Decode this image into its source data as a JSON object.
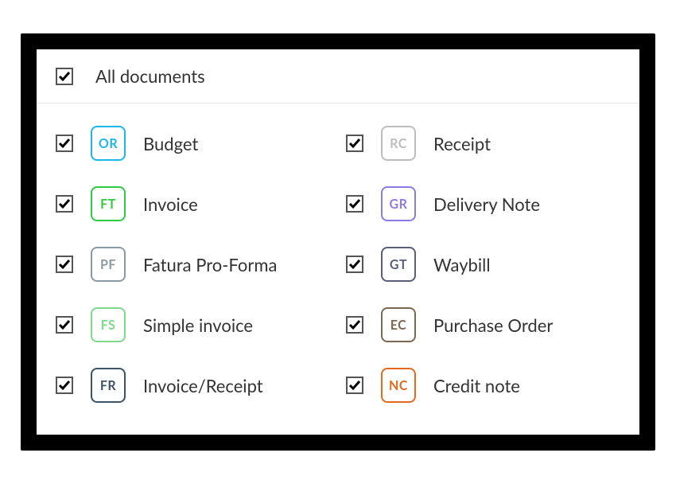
{
  "header": {
    "title": "All documents",
    "checked": true
  },
  "documents": [
    {
      "code": "OR",
      "label": "Budget",
      "color": "#1cb7e6",
      "checked": true
    },
    {
      "code": "RC",
      "label": "Receipt",
      "color": "#bdbdbd",
      "checked": true
    },
    {
      "code": "FT",
      "label": "Invoice",
      "color": "#2ecc40",
      "checked": true
    },
    {
      "code": "GR",
      "label": "Delivery Note",
      "color": "#8c7be6",
      "checked": true
    },
    {
      "code": "PF",
      "label": "Fatura Pro-Forma",
      "color": "#889aa4",
      "checked": true
    },
    {
      "code": "GT",
      "label": "Waybill",
      "color": "#5a5e7a",
      "checked": true
    },
    {
      "code": "FS",
      "label": "Simple invoice",
      "color": "#7fd98b",
      "checked": true
    },
    {
      "code": "EC",
      "label": "Purchase Order",
      "color": "#7a6850",
      "checked": true
    },
    {
      "code": "FR",
      "label": "Invoice/Receipt",
      "color": "#3d5466",
      "checked": true
    },
    {
      "code": "NC",
      "label": "Credit note",
      "color": "#e36a1e",
      "checked": true
    }
  ]
}
